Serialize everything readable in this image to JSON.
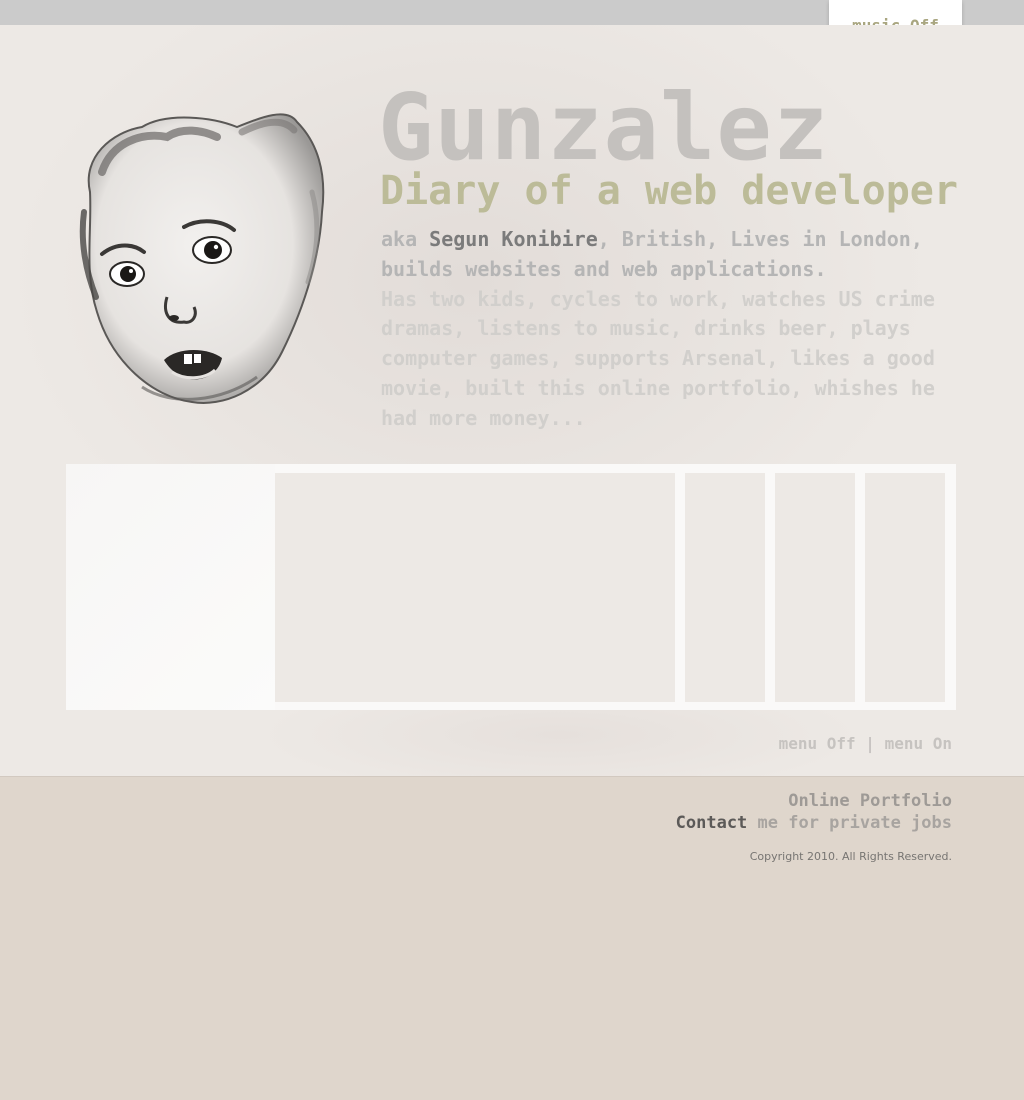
{
  "header": {
    "music_toggle": "music Off"
  },
  "hero": {
    "title": "Gunzalez",
    "tagline": "Diary of a web developer",
    "bio_prefix": "aka ",
    "bio_name": "Segun Konibire",
    "bio_line1_rest": ", British, Lives in London, builds websites and web applications.",
    "bio_more": "Has two kids, cycles to work, watches US crime dramas, listens to music, drinks beer, plays computer games, supports Arsenal, likes a good movie, built this online portfolio, whishes he had more money..."
  },
  "menu_toggle": {
    "off": "menu Off",
    "separator": " | ",
    "on": "menu On"
  },
  "footer": {
    "portfolio_link": "Online Portfolio",
    "contact_link": "Contact",
    "contact_rest": " me for private jobs",
    "copyright": "Copyright 2010. All Rights Reserved."
  },
  "colors": {
    "accent_olive": "#bcbb98",
    "title_gray": "#c4c1be",
    "footer_bg": "#dfd6cc",
    "main_bg": "#ede9e5"
  }
}
